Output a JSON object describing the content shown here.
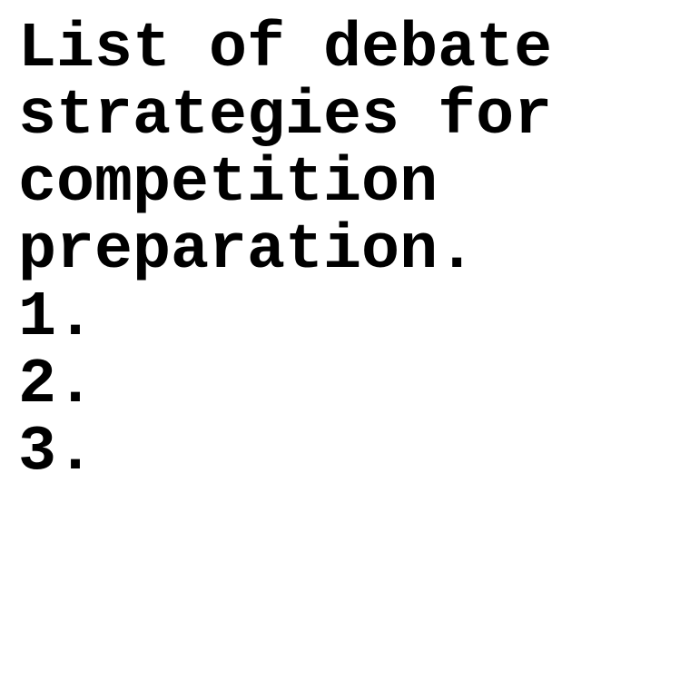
{
  "document": {
    "title_lines": [
      "List of debate",
      "strategies for",
      "competition",
      "preparation."
    ],
    "list_items": [
      "1.",
      "2.",
      "3."
    ]
  },
  "colors": {
    "background": "#ffffff",
    "text": "#000000"
  }
}
